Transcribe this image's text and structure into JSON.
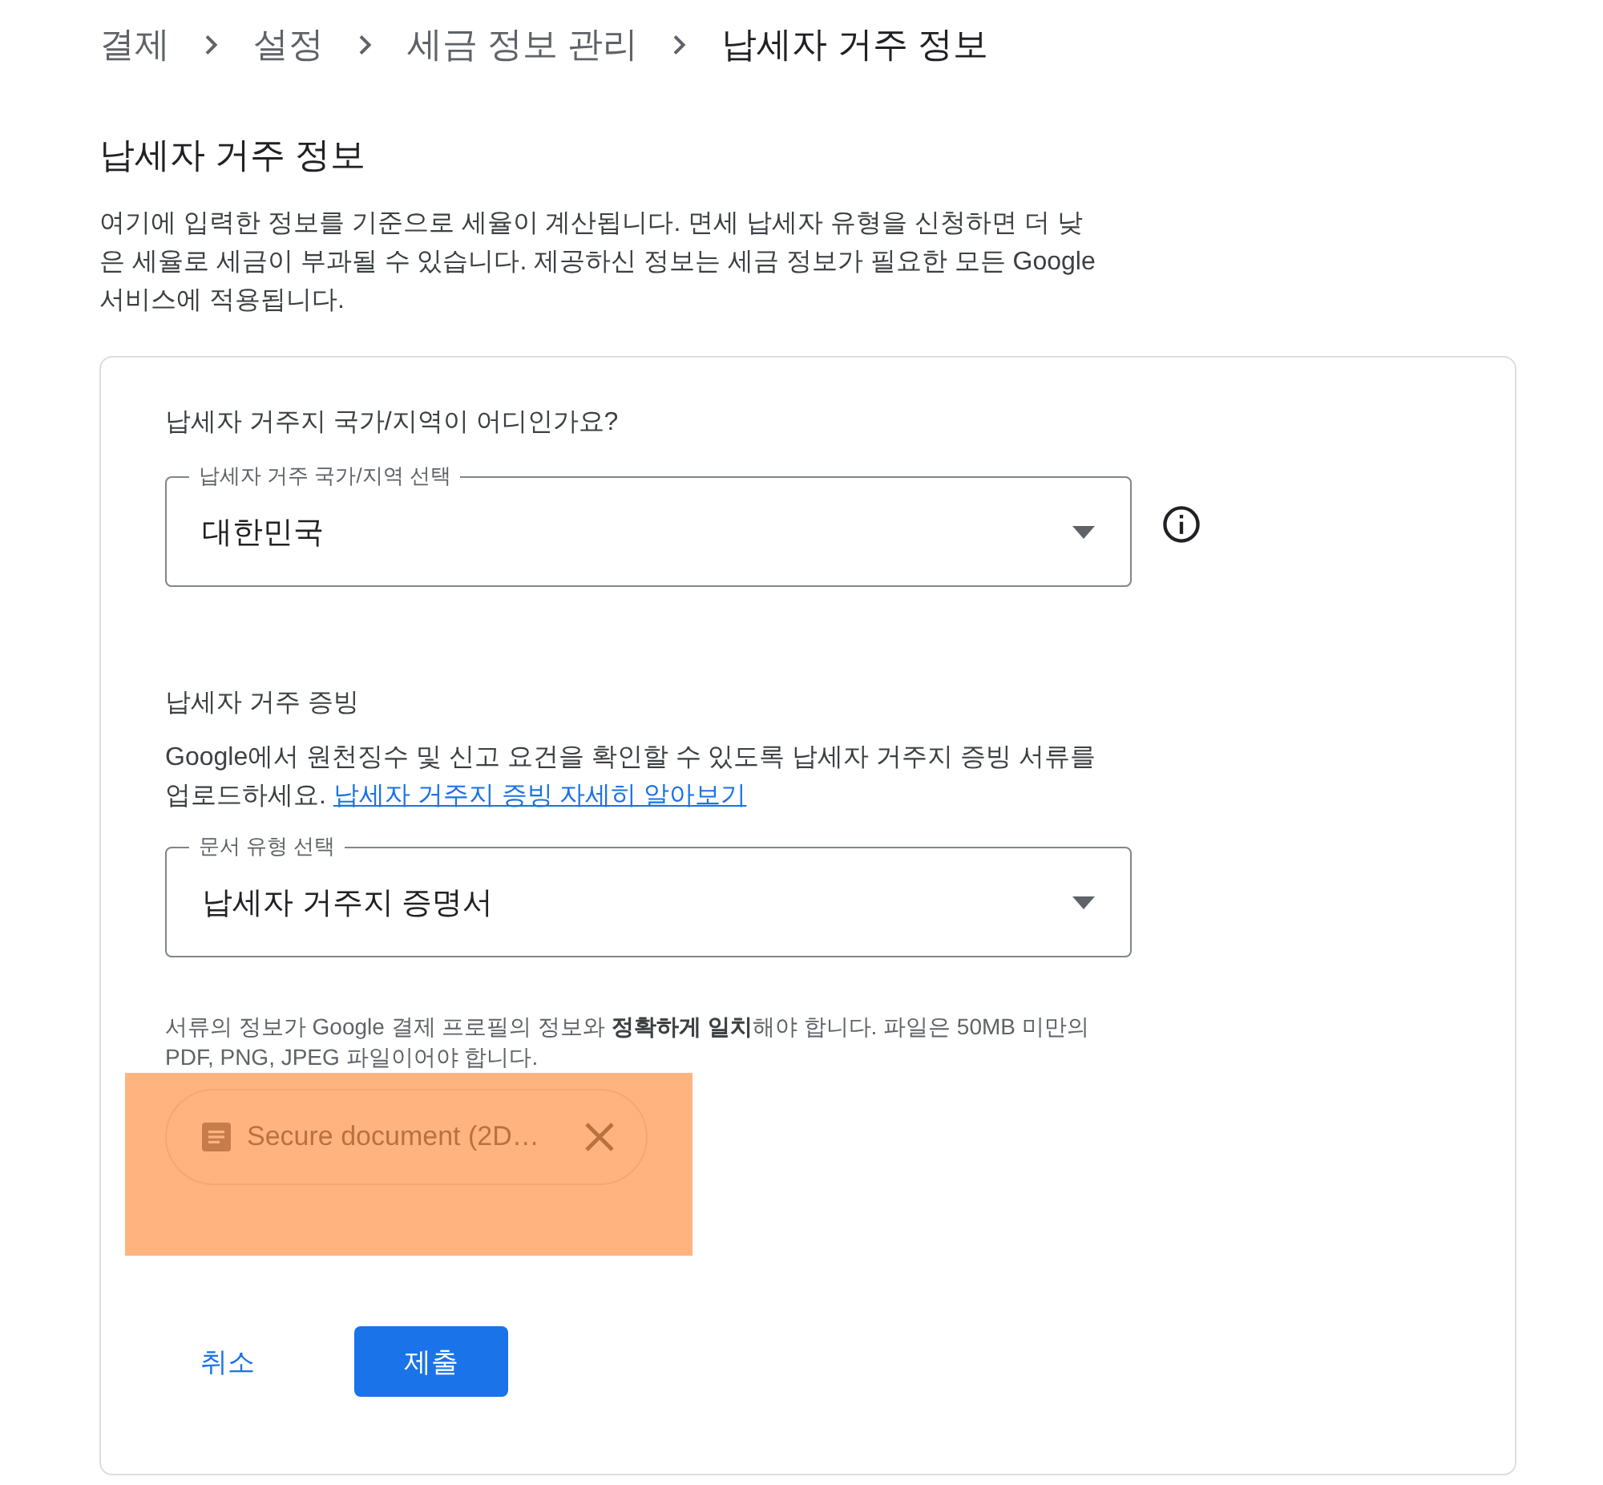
{
  "breadcrumb": [
    {
      "label": "결제",
      "current": false
    },
    {
      "label": "설정",
      "current": false
    },
    {
      "label": "세금 정보 관리",
      "current": false
    },
    {
      "label": "납세자 거주 정보",
      "current": true
    }
  ],
  "title": "납세자 거주 정보",
  "description": "여기에 입력한 정보를 기준으로 세율이 계산됩니다. 면세 납세자 유형을 신청하면 더 낮은 세율로 세금이 부과될 수 있습니다. 제공하신 정보는 세금 정보가 필요한 모든 Google 서비스에 적용됩니다.",
  "residence": {
    "question": "납세자 거주지 국가/지역이 어디인가요?",
    "select": {
      "label": "납세자 거주 국가/지역 선택",
      "value": "대한민국"
    }
  },
  "proof": {
    "heading": "납세자 거주 증빙",
    "text": "Google에서 원천징수 및 신고 요건을 확인할 수 있도록 납세자 거주지 증빙 서류를 업로드하세요.",
    "link": "납세자 거주지 증빙 자세히 알아보기",
    "select": {
      "label": "문서 유형 선택",
      "value": "납세자 거주지 증명서"
    },
    "helper": "서류의 정보가 Google 결제 프로필의 정보와 **정확하게 일치**해야 합니다. 파일은 50MB 미만의 PDF, PNG, JPEG 파일이어야 합니다.",
    "file_chip": "Secure document (2D…"
  },
  "buttons": {
    "cancel": "취소",
    "submit": "제출"
  }
}
